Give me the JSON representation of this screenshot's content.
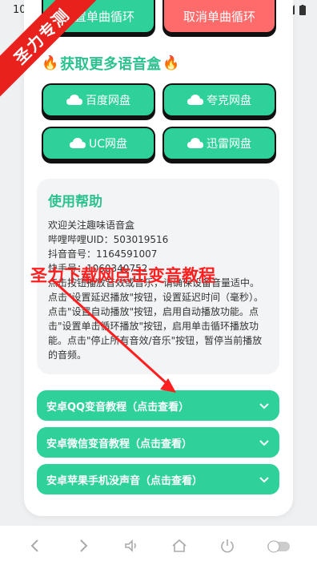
{
  "status": {
    "time": "10:0"
  },
  "top_buttons": {
    "set_loop": "设置单曲循环",
    "cancel_loop": "取消单曲循环"
  },
  "section": {
    "title": "获取更多语音盒"
  },
  "disks": [
    {
      "label": "百度网盘"
    },
    {
      "label": "夸克网盘"
    },
    {
      "label": "UC网盘"
    },
    {
      "label": "迅雷网盘"
    }
  ],
  "help": {
    "title": "使用帮助",
    "lines": [
      "欢迎关注趣味语音盒",
      "哔哩哔哩UID：503019516",
      "抖音音号：1164591007",
      "快手号：1060340752"
    ],
    "body": "点击按钮播放音效或音乐，请确保设备音量适中。点击\"设置延迟播放\"按钮，设置延迟时间（毫秒）。点击\"设置自动播放\"按钮，启用自动播放功能。点击\"设置单击循环播放\"按钮，启用单击循环播放功能。点击\"停止所有音效/音乐\"按钮，暂停当前播放的音频。"
  },
  "accordions": [
    {
      "label": "安卓QQ变音教程（点击查看）"
    },
    {
      "label": "安卓微信变音教程（点击查看）"
    },
    {
      "label": "安卓苹果手机没声音（点击查看）"
    }
  ],
  "watermark": {
    "corner": "圣力专测",
    "overlay": "圣力下载网点击变音教程"
  },
  "colors": {
    "accent": "#2dd199",
    "danger": "#ff6b6b",
    "title": "#2cc28f",
    "watermark": "#e8211c"
  }
}
